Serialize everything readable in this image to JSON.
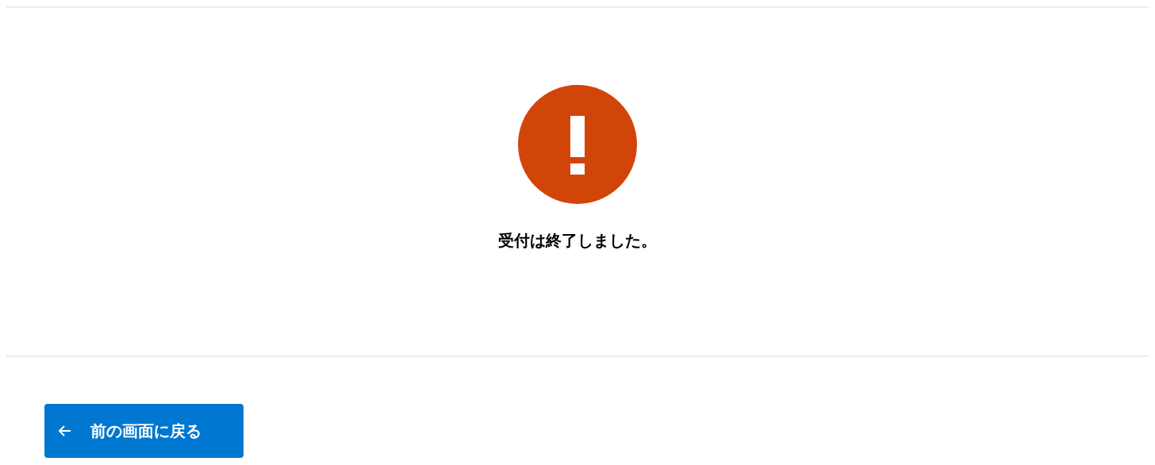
{
  "message": "受付は終了しました。",
  "back_button": {
    "label": "前の画面に戻る"
  }
}
